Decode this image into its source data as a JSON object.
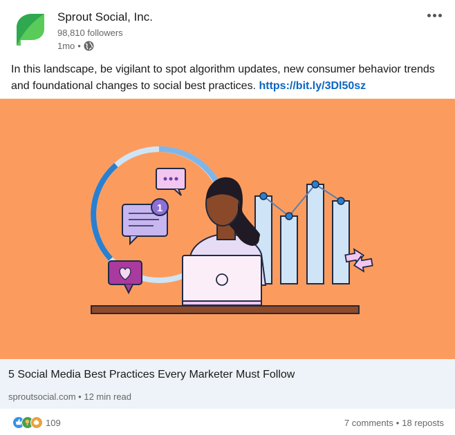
{
  "author": {
    "name": "Sprout Social, Inc.",
    "followers": "98,810 followers",
    "time": "1mo",
    "separator": "•"
  },
  "post": {
    "text": "In this landscape, be vigilant to spot algorithm updates, new consumer behavior trends and foundational changes to social best practices.",
    "link": "https://bit.ly/3Dl50sz"
  },
  "article": {
    "title": "5 Social Media Best Practices Every Marketer Must Follow",
    "source": "sproutsocial.com",
    "separator": "•",
    "read_time": "12 min read",
    "image_background": "#fb9c5e"
  },
  "social": {
    "reaction_count": "109",
    "comments": "7 comments",
    "separator": "•",
    "reposts": "18 reposts"
  },
  "icons": {
    "logo": "sprout-leaf-logo",
    "visibility": "globe-icon",
    "menu": "more-options-icon",
    "reactions": [
      "like-reaction-icon",
      "celebrate-reaction-icon",
      "support-reaction-icon"
    ]
  },
  "colors": {
    "link": "#0a66c2",
    "brand_green": "#59cb59",
    "article_bg": "#edf3f8"
  }
}
